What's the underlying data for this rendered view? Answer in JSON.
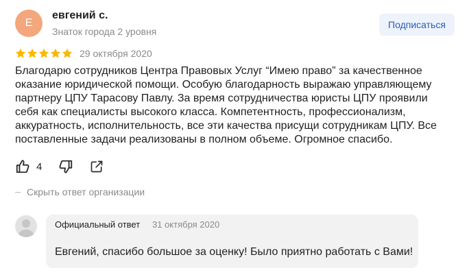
{
  "author": {
    "initial": "Е",
    "name": "евгений с.",
    "level": "Знаток города 2 уровня"
  },
  "subscribe_label": "Подписаться",
  "rating": {
    "stars": 5,
    "max": 5,
    "color": "#fcb800"
  },
  "review": {
    "date": "29 октября 2020",
    "text": "Благодарю сотрудников Центра Правовых Услуг “Имею право” за качественное оказание юридической помощи. Особую благодарность выражаю управляющему партнеру ЦПУ Тарасову Павлу. За время сотрудничества юристы ЦПУ проявили себя как специалисты высокого класса. Компетентность, профессионализм, аккуратность, исполнительность, все эти качества присущи сотрудникам ЦПУ. Все поставленные задачи реализованы в полном объеме. Огромное спасибо."
  },
  "actions": {
    "like_icon": "thumbs-up-icon",
    "likes": "4",
    "dislike_icon": "thumbs-down-icon",
    "share_icon": "share-icon"
  },
  "toggle_answer_label": "Скрыть ответ организации",
  "org_answer": {
    "label": "Официальный ответ",
    "date": "31 октября 2020",
    "text": "Евгений, спасибо большое за оценку! Было приятно работать с Вами!"
  },
  "colors": {
    "avatar_bg": "#f3a77c",
    "subscribe_bg": "#eef2fb",
    "subscribe_text": "#2a5cba",
    "answer_bg": "#f2f2f2"
  }
}
